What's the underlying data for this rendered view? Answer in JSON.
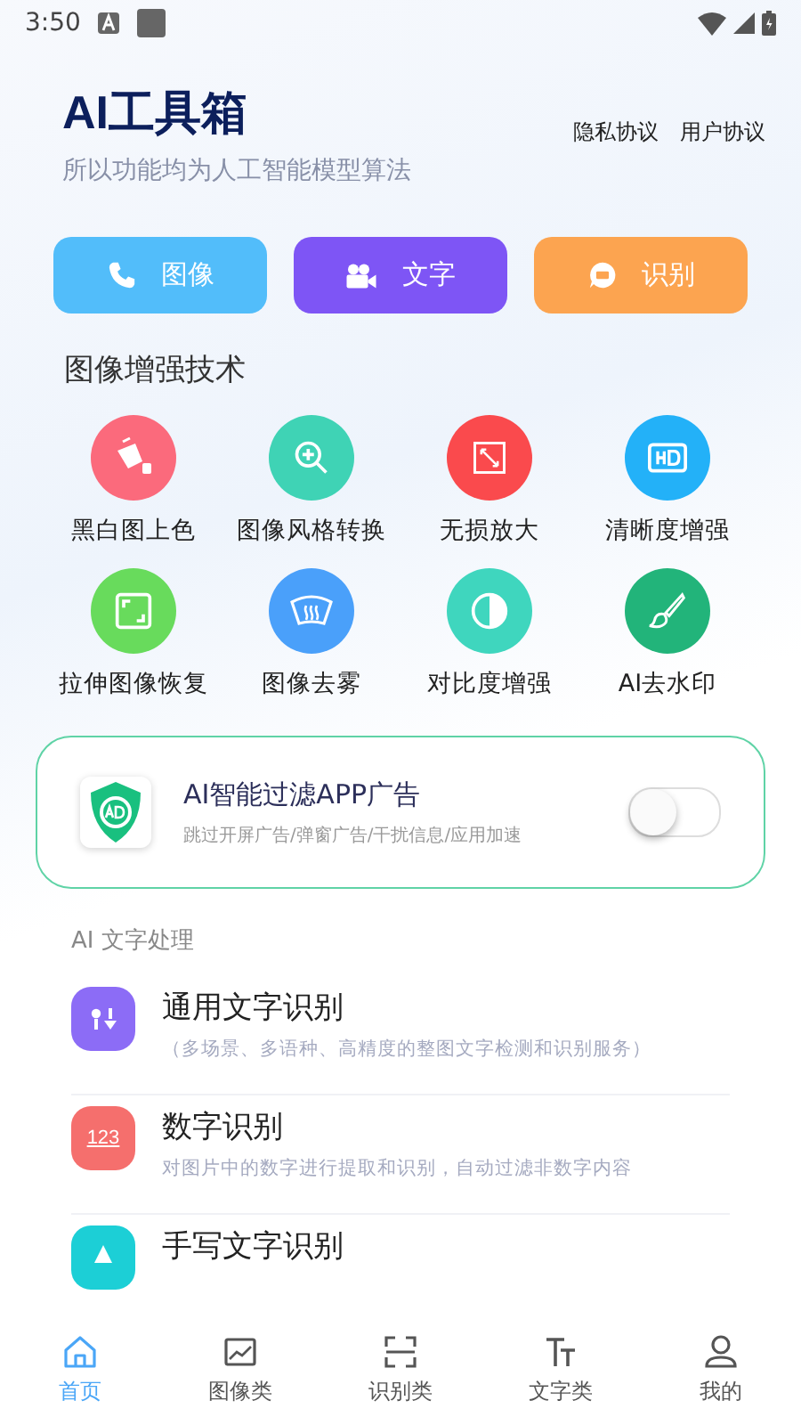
{
  "status_bar": {
    "time": "3:50"
  },
  "header": {
    "title": "AI工具箱",
    "subtitle": "所以功能均为人工智能模型算法",
    "links": [
      "隐私协议",
      "用户协议"
    ]
  },
  "quick_buttons": [
    {
      "label": "图像",
      "kind": "phone",
      "color": "#52bdfa"
    },
    {
      "label": "文字",
      "kind": "camera",
      "color": "#7e55f5"
    },
    {
      "label": "识别",
      "kind": "chat",
      "color": "#fca450"
    }
  ],
  "enhance": {
    "title": "图像增强技术",
    "tools": [
      {
        "label": "黑白图上色",
        "kind": "bucket",
        "color": "#fb6a7c"
      },
      {
        "label": "图像风格转换",
        "kind": "zoom",
        "color": "#3fd3b5"
      },
      {
        "label": "无损放大",
        "kind": "expand",
        "color": "#fa4a4d"
      },
      {
        "label": "清晰度增强",
        "kind": "hd",
        "color": "#23b1f8"
      },
      {
        "label": "拉伸图像恢复",
        "kind": "frame",
        "color": "#68db5c"
      },
      {
        "label": "图像去雾",
        "kind": "defog",
        "color": "#4aa0fa"
      },
      {
        "label": "对比度增强",
        "kind": "contrast",
        "color": "#3fd6be"
      },
      {
        "label": "AI去水印",
        "kind": "brush",
        "color": "#22b47a"
      }
    ]
  },
  "ad_filter": {
    "title": "AI智能过滤APP广告",
    "description": "跳过开屏广告/弹窗广告/干扰信息/应用加速",
    "on": false
  },
  "text_section": {
    "title": "AI 文字处理",
    "items": [
      {
        "title": "通用文字识别",
        "description": "（多场景、多语种、高精度的整图文字检测和识别服务）",
        "kind": "sliders",
        "color": "#8c6cf6"
      },
      {
        "title": "数字识别",
        "description": "对图片中的数字进行提取和识别，自动过滤非数字内容",
        "kind": "digits",
        "icon_text": "123",
        "color": "#f56f6d"
      },
      {
        "title": "手写文字识别",
        "kind": "pen",
        "color": "#1ccfd6"
      }
    ]
  },
  "bottom_nav": [
    {
      "label": "首页",
      "kind": "home",
      "selected": true
    },
    {
      "label": "图像类",
      "kind": "image",
      "selected": false
    },
    {
      "label": "识别类",
      "kind": "scan",
      "selected": false
    },
    {
      "label": "文字类",
      "kind": "text",
      "selected": false
    },
    {
      "label": "我的",
      "kind": "user",
      "selected": false
    }
  ]
}
